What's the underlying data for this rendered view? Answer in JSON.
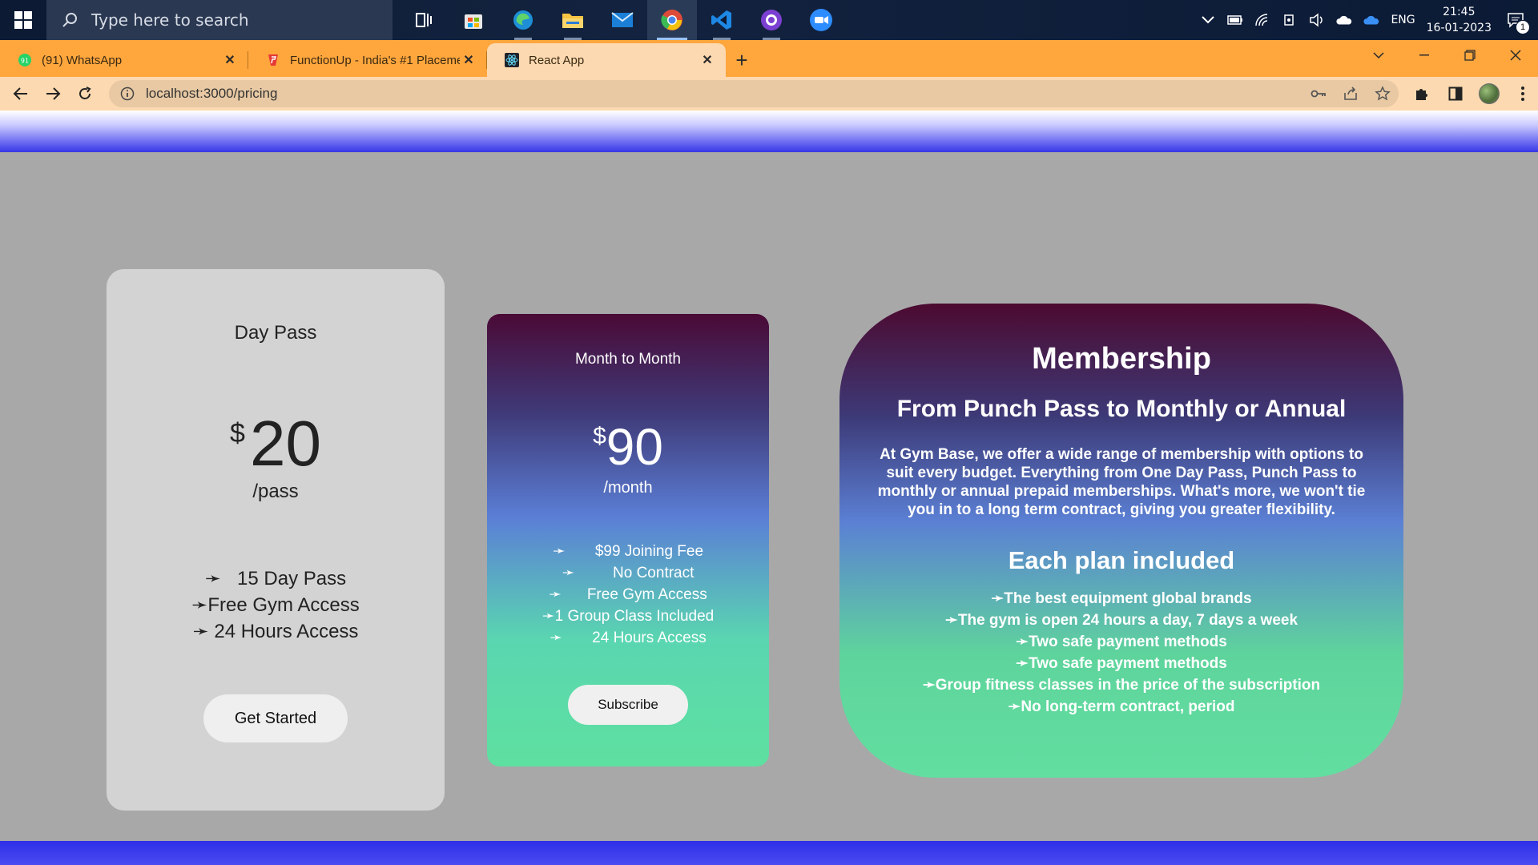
{
  "taskbar": {
    "search_placeholder": "Type here to search",
    "language": "ENG",
    "time": "21:45",
    "date": "16-01-2023",
    "notification_count": "1"
  },
  "browser": {
    "tabs": [
      {
        "label": "(91) WhatsApp",
        "icon": "whatsapp-icon"
      },
      {
        "label": "FunctionUp - India's #1 Placement",
        "icon": "functionup-icon"
      },
      {
        "label": "React App",
        "icon": "react-icon"
      }
    ],
    "url": "localhost:3000/pricing"
  },
  "colors": {
    "tab_strip": "#ffa63d",
    "toolbar": "#fcd9b0",
    "page_background": "#a8a8a8",
    "band": "#3737e6"
  },
  "day_pass": {
    "title": "Day Pass",
    "currency": "$",
    "amount": "20",
    "period": "/pass",
    "features": [
      "➛   15 Day Pass",
      "➛Free Gym Access",
      "➛ 24 Hours Access"
    ],
    "button": "Get Started"
  },
  "month_pass": {
    "title": "Month to Month",
    "currency": "$",
    "amount": "90",
    "period": "/month",
    "features": [
      "➛       $99 Joining Fee",
      "➛         No Contract",
      "➛      Free Gym Access",
      "➛1 Group Class Included",
      "➛       24 Hours Access"
    ],
    "button": "Subscribe"
  },
  "membership": {
    "title": "Membership",
    "subtitle": "From Punch Pass to Monthly or Annual",
    "description": "At Gym Base, we offer a wide range of membership with options to suit every budget. Everything from One Day Pass, Punch Pass to monthly or annual prepaid memberships. What's more, we won't tie you in to a long term contract, giving you greater flexibility.",
    "included_heading": "Each plan included",
    "included": [
      "➛The best equipment global brands",
      "➛The gym is open 24 hours a day, 7 days a week",
      "➛Two safe payment methods",
      "➛Two safe payment methods",
      "➛Group fitness classes in the price of the subscription",
      "➛No long-term contract, period"
    ]
  }
}
